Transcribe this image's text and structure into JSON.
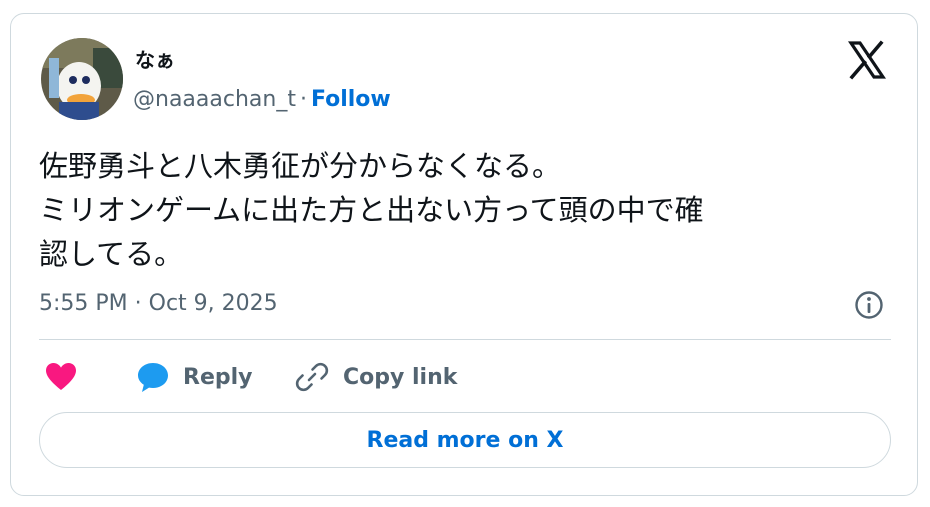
{
  "author": {
    "display_name": "なぁ",
    "handle": "@naaaachan_t",
    "separator": "·",
    "follow_label": "Follow"
  },
  "tweet": {
    "text": "佐野勇斗と八木勇征が分からなくなる。\nミリオンゲームに出た方と出ない方って頭の中で確\n認してる。",
    "timestamp": "5:55 PM · Oct 9, 2025"
  },
  "actions": {
    "like_icon": "heart-icon",
    "reply_label": "Reply",
    "copy_label": "Copy link"
  },
  "footer": {
    "read_more_label": "Read more on X"
  },
  "colors": {
    "link": "#006fd6",
    "like": "#f91880",
    "reply": "#1d9bf0",
    "muted": "#536471",
    "text": "#0f1419",
    "border": "#cfd9de"
  }
}
